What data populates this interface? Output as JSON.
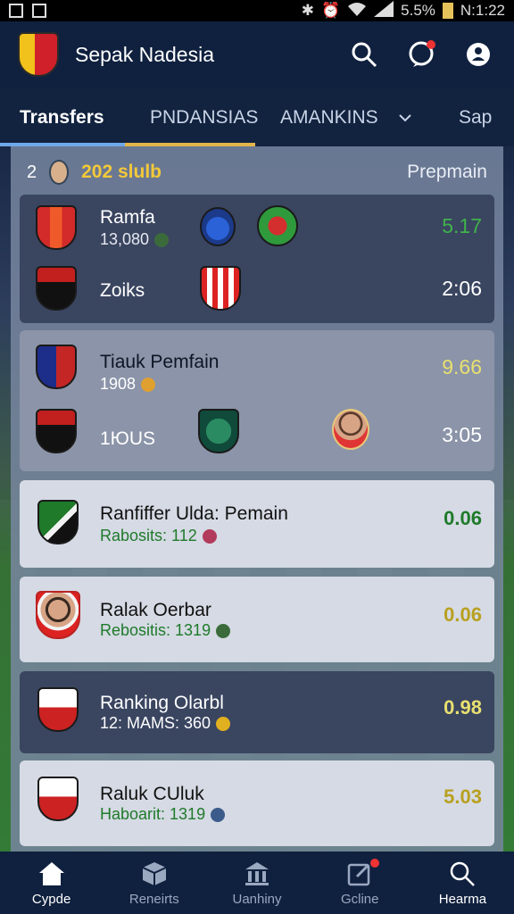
{
  "status_bar": {
    "battery": "5.5%",
    "time": "N:1:22"
  },
  "app": {
    "title": "Sepak Nadesia"
  },
  "tabs": [
    "Transfers",
    "PNDANSIAS",
    "AMANKINS",
    "Sap"
  ],
  "panel_header": {
    "number": "2",
    "season": "202 slulb",
    "filter": "Prepmain"
  },
  "cards": [
    {
      "title": "Ramfa",
      "subtitle": "13,080",
      "score": "5.17",
      "style": "dark"
    },
    {
      "title": "Zoiks",
      "score": "2:06",
      "style": "dark"
    },
    {
      "title": "Tiauk Pemfain",
      "subtitle": "1908",
      "score": "9.66",
      "style": "mid"
    },
    {
      "title": "1ЮUS",
      "score": "3:05",
      "style": "mid"
    },
    {
      "title": "Ranfiffer Ulda: Pemain",
      "subtitle": "Rabosits: 112",
      "score": "0.06",
      "style": "light"
    },
    {
      "title": "Ralak Oerbar",
      "subtitle": "Rebositis: 1319",
      "score": "0.06",
      "style": "light"
    },
    {
      "title": "Ranking Olarbl",
      "subtitle": "12: MAMS:  360",
      "score": "0.98",
      "style": "dark"
    },
    {
      "title": "Raluk CUluk",
      "subtitle": "Haboarit: 1319",
      "score": "5.03",
      "style": "light"
    }
  ],
  "bottom_nav": [
    {
      "label": "Cypde",
      "icon": "home-icon"
    },
    {
      "label": "Reneirts",
      "icon": "box-icon"
    },
    {
      "label": "Uanhiny",
      "icon": "bank-icon"
    },
    {
      "label": "Gcline",
      "icon": "edit-icon"
    },
    {
      "label": "Hearma",
      "icon": "search-icon"
    }
  ],
  "colors": {
    "accent_gold": "#f3c93a",
    "score_green": "#1f7a2a",
    "tab_blue": "#6fa8e8"
  }
}
